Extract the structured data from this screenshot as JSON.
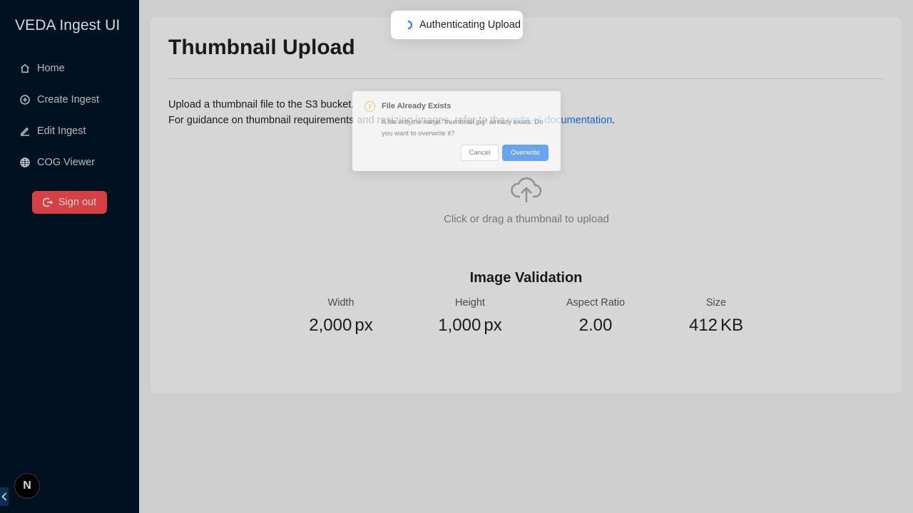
{
  "app": {
    "title": "VEDA Ingest UI"
  },
  "sidebar": {
    "items": [
      {
        "label": "Home",
        "icon": "home-icon"
      },
      {
        "label": "Create Ingest",
        "icon": "plus-circle-icon"
      },
      {
        "label": "Edit Ingest",
        "icon": "edit-icon"
      },
      {
        "label": "COG Viewer",
        "icon": "globe-icon"
      }
    ],
    "signout_label": "Sign out",
    "badge_label": "N"
  },
  "page": {
    "title": "Thumbnail Upload",
    "desc_line1": "Upload a thumbnail file to the S3 bucket.",
    "desc_line2_prefix": "For guidance on thumbnail requirements and resizing images, refer to the ",
    "desc_link": "veda-ui documentation",
    "desc_line2_suffix": ".",
    "upload_text": "Click or drag a thumbnail to upload"
  },
  "validation": {
    "title": "Image Validation",
    "stats": [
      {
        "label": "Width",
        "value": "2,000",
        "unit": "px"
      },
      {
        "label": "Height",
        "value": "1,000",
        "unit": "px"
      },
      {
        "label": "Aspect Ratio",
        "value": "2.00",
        "unit": ""
      },
      {
        "label": "Size",
        "value": "412",
        "unit": "KB"
      }
    ]
  },
  "modal": {
    "title": "File Already Exists",
    "body": "A file with the name \"thumbnail.jpg\" already exists. Do you want to overwrite it?",
    "cancel_label": "Cancel",
    "ok_label": "Overwrite"
  },
  "toast": {
    "text": "Authenticating Upload"
  },
  "colors": {
    "sidebar_bg": "#001529",
    "accent": "#1677ff",
    "danger": "#ff4d4f",
    "warning": "#faad14"
  }
}
